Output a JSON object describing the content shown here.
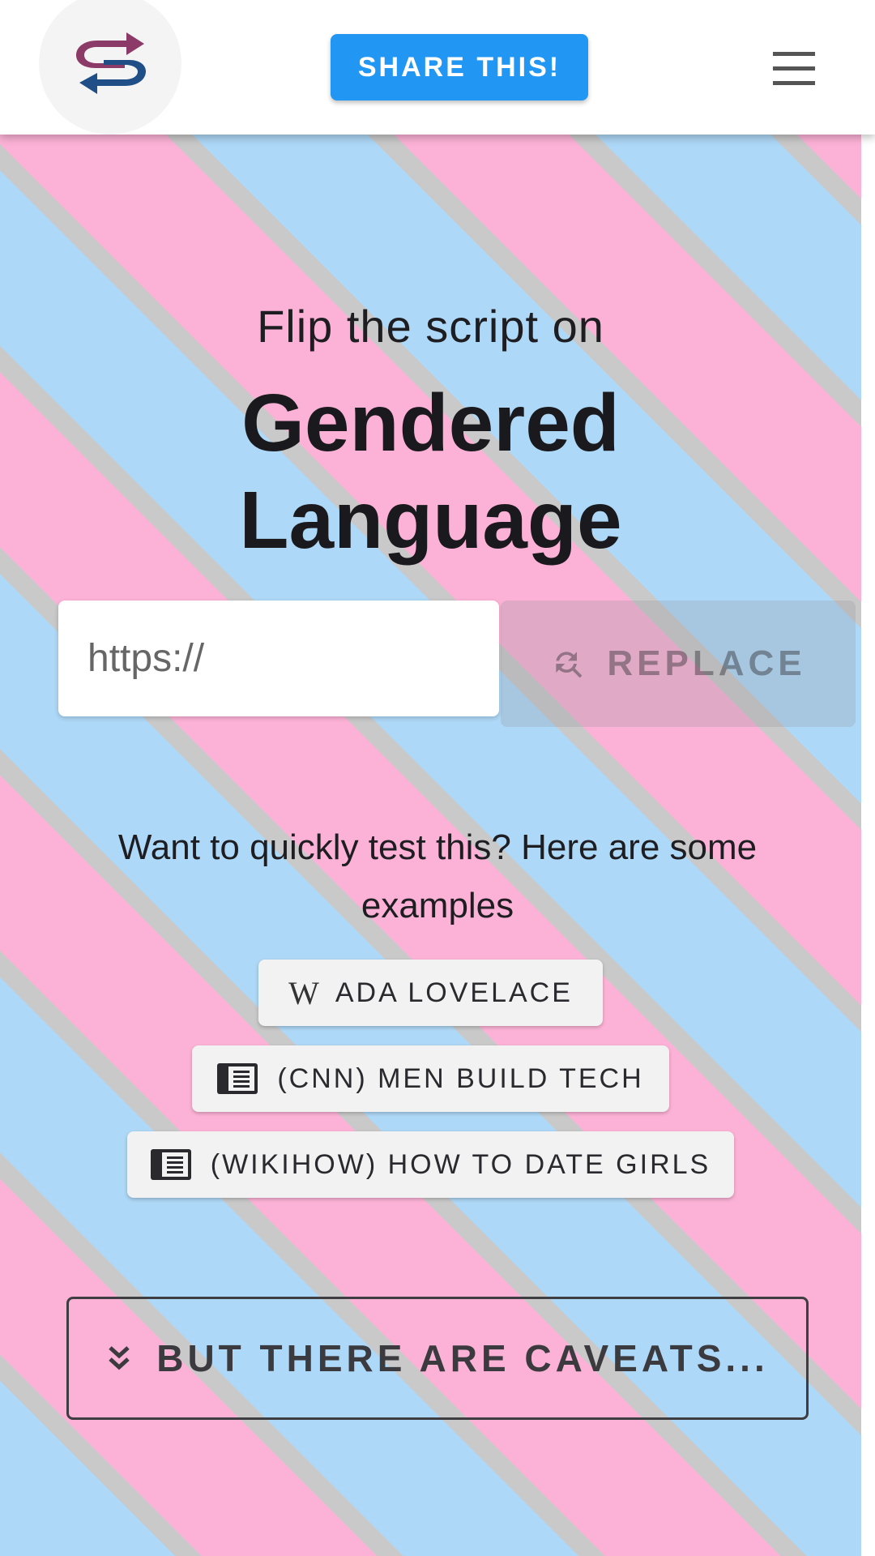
{
  "header": {
    "share_label": "SHARE THIS!",
    "logo_colors": {
      "top_arrow": "#8c3a68",
      "bottom_arrow": "#1f4f86"
    }
  },
  "hero": {
    "subtitle": "Flip the script on",
    "title_line1": "Gendered",
    "title_line2": "Language"
  },
  "url_input": {
    "placeholder": "https://"
  },
  "replace_button": {
    "label": "REPLACE",
    "icon": "find-replace-icon"
  },
  "examples": {
    "intro": "Want to quickly test this? Here are some examples",
    "items": [
      {
        "icon": "wikipedia-icon",
        "icon_text": "W",
        "label": "ADA LOVELACE"
      },
      {
        "icon": "newspaper-icon",
        "label": "(CNN) MEN BUILD TECH"
      },
      {
        "icon": "newspaper-icon",
        "label": "(WIKIHOW) HOW TO DATE GIRLS"
      }
    ]
  },
  "caveats": {
    "label": "BUT THERE ARE CAVEATS...",
    "icon": "double-chevron-down-icon"
  },
  "colors": {
    "accent": "#2196f3",
    "stripe_blue": "#aed8f7",
    "stripe_pink": "#fcb2d6",
    "stripe_gray": "#c9c9c9"
  }
}
